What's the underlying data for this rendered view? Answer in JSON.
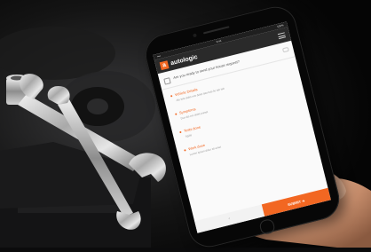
{
  "colors": {
    "accent": "#f26722",
    "header": "#2a2a2a",
    "screen_bg": "#fafafa"
  },
  "app": {
    "logo_letter": "a",
    "brand": "autologic",
    "status_carrier": "••••",
    "status_time": "9:41",
    "status_battery": "100%"
  },
  "form": {
    "question": "Are you ready to send your house request?",
    "sections": [
      {
        "title": "Vehicle Details",
        "value": "Ale tela dolet nos dolet tata  bab lio tab tab"
      },
      {
        "title": "Symptoms",
        "value": "Dux dis em dolet presst"
      },
      {
        "title": "Tests done",
        "value": "Sgids"
      },
      {
        "title": "Work done",
        "value": "Lorem ipsum dolor sit amet"
      }
    ],
    "back_label": "‹",
    "submit_label": "SUBMIT ➔"
  },
  "icons": [
    "wrench-icon",
    "phone-icon",
    "menu-icon",
    "checkbox-icon",
    "arrow-right-icon"
  ]
}
